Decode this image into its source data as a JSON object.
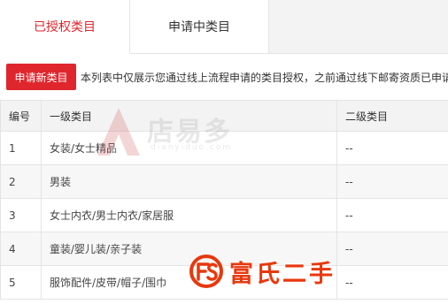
{
  "tabs": [
    {
      "label": "已授权类目"
    },
    {
      "label": "申请中类目"
    }
  ],
  "toolbar": {
    "apply_label": "申请新类目",
    "notice": "本列表中仅展示您通过线上流程申请的类目授权，之前通过线下邮寄资质已申请的类目"
  },
  "table": {
    "headers": [
      "编号",
      "一级类目",
      "二级类目"
    ],
    "rows": [
      {
        "id": "1",
        "primary": "女装/女士精品",
        "secondary": "--"
      },
      {
        "id": "2",
        "primary": "男装",
        "secondary": "--"
      },
      {
        "id": "3",
        "primary": "女士内衣/男士内衣/家居服",
        "secondary": "--"
      },
      {
        "id": "4",
        "primary": "童装/婴儿装/亲子装",
        "secondary": "--"
      },
      {
        "id": "5",
        "primary": "服饰配件/皮带/帽子/围巾",
        "secondary": "--"
      }
    ]
  },
  "watermark": {
    "text": "店易多",
    "sub": "dianyiduo.com"
  },
  "brand_overlay": {
    "text": "富氏二手"
  },
  "colors": {
    "accent": "#e0262d",
    "brand": "#e8380d"
  }
}
